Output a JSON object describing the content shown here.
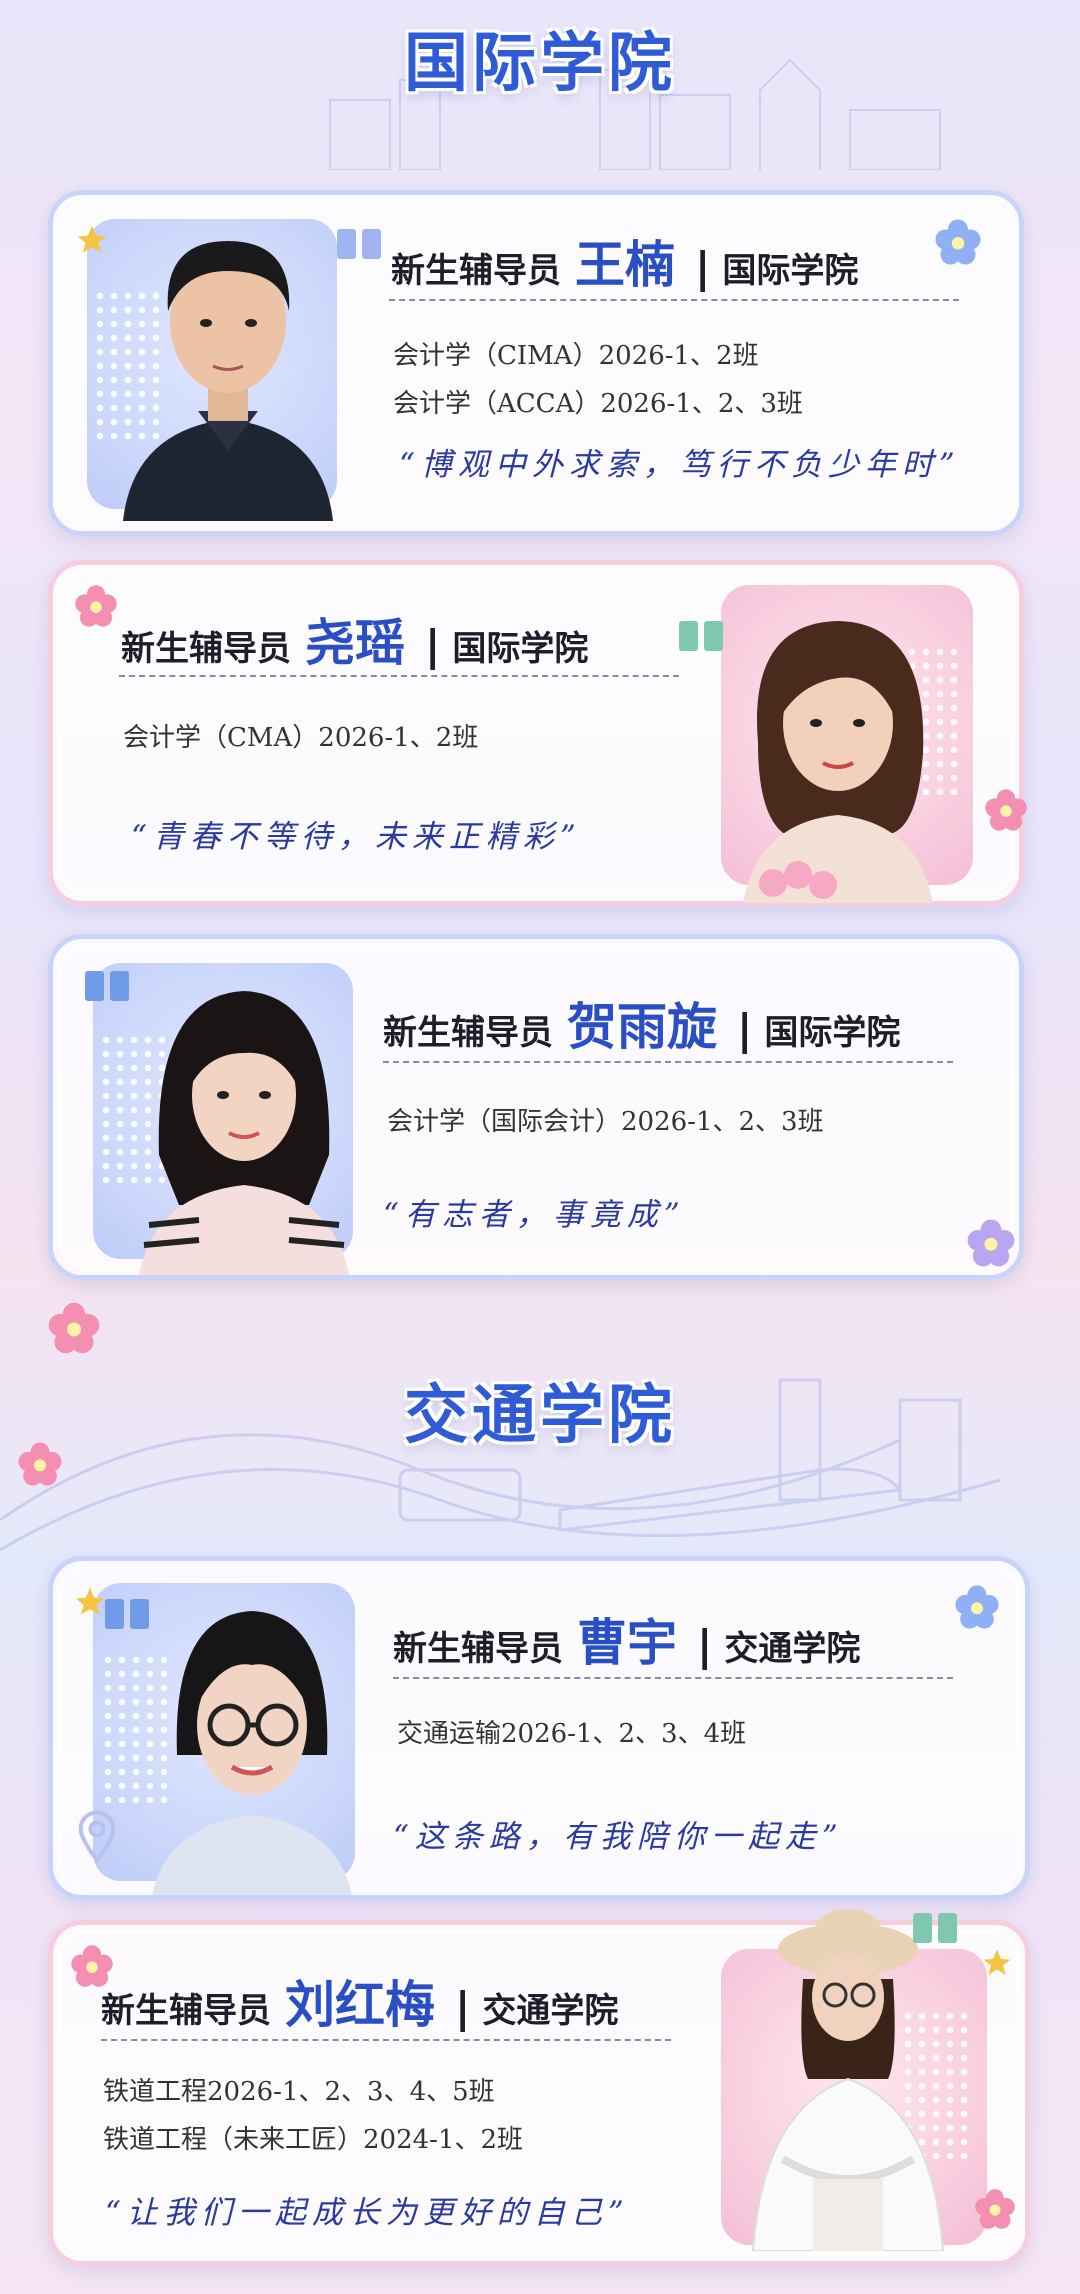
{
  "sections": [
    {
      "title": "国际学院"
    },
    {
      "title": "交通学院"
    }
  ],
  "cards": [
    {
      "role": "新生辅导员",
      "name": "王楠",
      "college": "国际学院",
      "classes": [
        "会计学（CIMA）2026-1、2班",
        "会计学（ACCA）2026-1、2、3班"
      ],
      "quote": "“博观中外求索，笃行不负少年时”"
    },
    {
      "role": "新生辅导员",
      "name": "尧瑶",
      "college": "国际学院",
      "classes": [
        "会计学（CMA）2026-1、2班"
      ],
      "quote": "“青春不等待，未来正精彩”"
    },
    {
      "role": "新生辅导员",
      "name": "贺雨旋",
      "college": "国际学院",
      "classes": [
        "会计学（国际会计）2026-1、2、3班"
      ],
      "quote": "“有志者，事竟成”"
    },
    {
      "role": "新生辅导员",
      "name": "曹宇",
      "college": "交通学院",
      "classes": [
        "交通运输2026-1、2、3、4班"
      ],
      "quote": "“这条路，有我陪你一起走”"
    },
    {
      "role": "新生辅导员",
      "name": "刘红梅",
      "college": "交通学院",
      "classes": [
        "铁道工程2026-1、2、3、4、5班",
        "铁道工程（未来工匠）2024-1、2班"
      ],
      "quote": "“让我们一起成长为更好的自己”"
    }
  ],
  "colors": {
    "accent": "#2f5bd6",
    "name": "#2a4ec4",
    "quote": "#2b3aa0",
    "blue_border": "#c9d4fb",
    "pink_border": "#f7cde0"
  }
}
